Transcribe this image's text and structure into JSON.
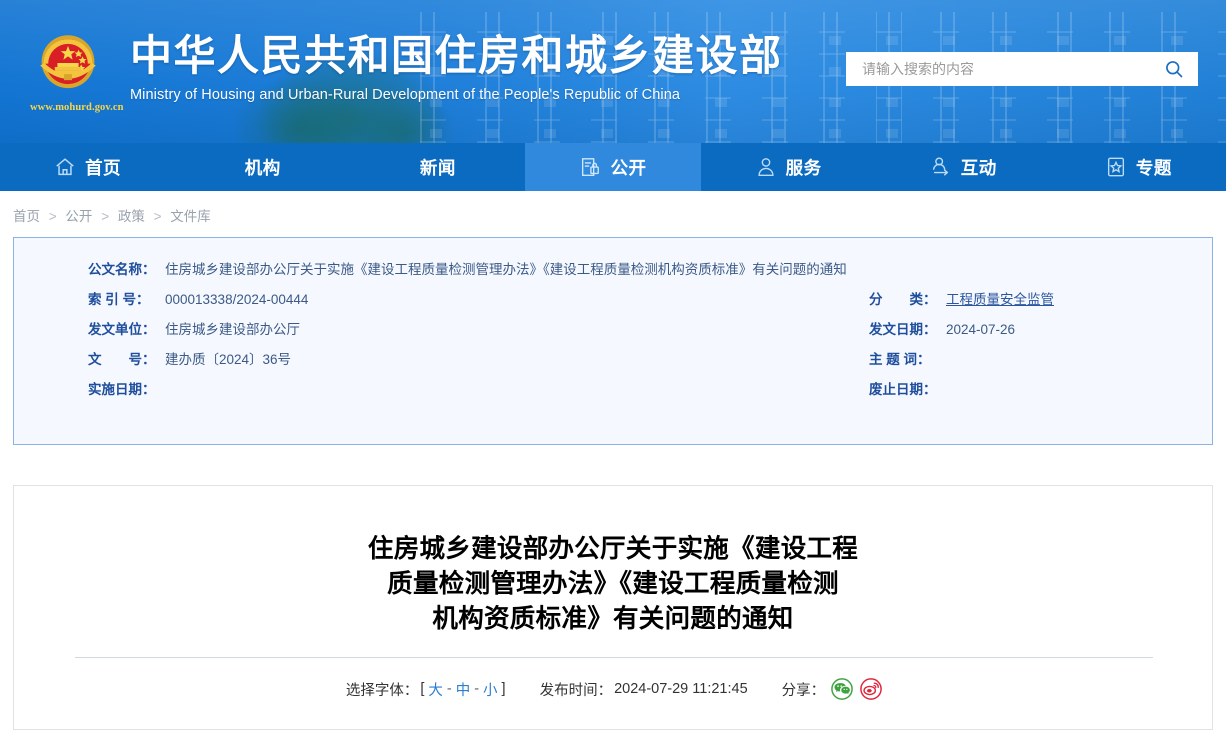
{
  "header": {
    "emblem_icon": "china-national-emblem",
    "site_url": "www.mohurd.gov.cn",
    "title_cn": "中华人民共和国住房和城乡建设部",
    "title_en": "Ministry of Housing and Urban-Rural Development of the People's Republic of China",
    "search": {
      "placeholder": "请输入搜索的内容",
      "value": "",
      "button_icon": "search-icon"
    }
  },
  "nav": {
    "items": [
      {
        "label": "首页",
        "icon": "home-icon",
        "active": false
      },
      {
        "label": "机构",
        "icon": "",
        "active": false
      },
      {
        "label": "新闻",
        "icon": "",
        "active": false
      },
      {
        "label": "公开",
        "icon": "document-lock-icon",
        "active": true
      },
      {
        "label": "服务",
        "icon": "person-service-icon",
        "active": false
      },
      {
        "label": "互动",
        "icon": "person-exchange-icon",
        "active": false
      },
      {
        "label": "专题",
        "icon": "star-box-icon",
        "active": false
      }
    ]
  },
  "breadcrumb": {
    "items": [
      "首页",
      "公开",
      "政策",
      "文件库"
    ],
    "separator": ">"
  },
  "meta": {
    "left_rows": [
      {
        "label": "公文名称：",
        "value": "住房城乡建设部办公厅关于实施《建设工程质量检测管理办法》《建设工程质量检测机构资质标准》有关问题的通知",
        "link": false
      },
      {
        "label": "索 引 号：",
        "value": "000013338/2024-00444",
        "link": false
      },
      {
        "label": "发文单位：",
        "value": "住房城乡建设部办公厅",
        "link": false
      },
      {
        "label": "文　　号：",
        "value": "建办质〔2024〕36号",
        "link": false
      },
      {
        "label": "实施日期：",
        "value": "",
        "link": false
      }
    ],
    "right_rows": [
      {
        "label": "分　　类：",
        "value": "工程质量安全监管",
        "link": true
      },
      {
        "label": "发文日期：",
        "value": "2024-07-26",
        "link": false
      },
      {
        "label": "主 题 词：",
        "value": "",
        "link": false
      },
      {
        "label": "废止日期：",
        "value": "",
        "link": false
      }
    ]
  },
  "document": {
    "title_lines": [
      "住房城乡建设部办公厅关于实施《建设工程",
      "质量检测管理办法》《建设工程质量检测",
      "机构资质标准》有关问题的通知"
    ],
    "toolbar": {
      "font_label": "选择字体：",
      "bracket_open": "[",
      "bracket_close": "]",
      "font_large": "大",
      "font_medium": "中",
      "font_small": "小",
      "dash": "-",
      "publish_label": "发布时间：",
      "publish_time": "2024-07-29 11:21:45",
      "share_label": "分享：",
      "share_items": [
        {
          "icon": "wechat-icon",
          "color": "#3ea33e"
        },
        {
          "icon": "weibo-icon",
          "color": "#e0243a"
        }
      ]
    }
  },
  "colors": {
    "nav_bg": "#0b6bc0",
    "nav_active": "#3189de",
    "card_bg": "#f5f8fe",
    "card_border": "#8bb5de",
    "label_blue": "#1f4e9c",
    "link_blue": "#2b7fd1"
  }
}
